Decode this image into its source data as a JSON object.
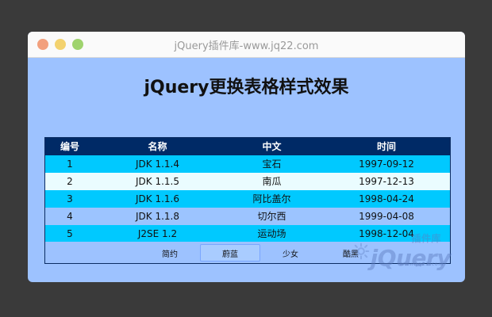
{
  "window": {
    "title": "jQuery插件库-www.jq22.com"
  },
  "page": {
    "title": "jQuery更换表格样式效果"
  },
  "table": {
    "headers": [
      "编号",
      "名称",
      "中文",
      "时间"
    ],
    "rows": [
      {
        "id": "1",
        "name": "JDK 1.1.4",
        "cn": "宝石",
        "date": "1997-09-12"
      },
      {
        "id": "2",
        "name": "JDK 1.1.5",
        "cn": "南瓜",
        "date": "1997-12-13"
      },
      {
        "id": "3",
        "name": "JDK 1.1.6",
        "cn": "阿比盖尔",
        "date": "1998-04-24"
      },
      {
        "id": "4",
        "name": "JDK 1.1.8",
        "cn": "切尔西",
        "date": "1999-04-08"
      },
      {
        "id": "5",
        "name": "J2SE 1.2",
        "cn": "运动场",
        "date": "1998-12-04"
      }
    ]
  },
  "themes": {
    "options": [
      "简约",
      "蔚蓝",
      "少女",
      "酷黑"
    ],
    "selected": "蔚蓝"
  },
  "watermark": {
    "logo": "jQuery",
    "chinese": "插件库",
    "url": "www.jq22.com"
  },
  "colors": {
    "background": "#3a3a3a",
    "window_bg": "#9dc2ff",
    "header_bg": "#002a66",
    "row_cyan": "#00c9ff",
    "row_white": "#eafcff",
    "row_blue": "#9cc4ff"
  },
  "icons": {
    "window_controls": [
      "close-icon",
      "minimize-icon",
      "maximize-icon"
    ],
    "watermark_gear": "gear-icon"
  }
}
